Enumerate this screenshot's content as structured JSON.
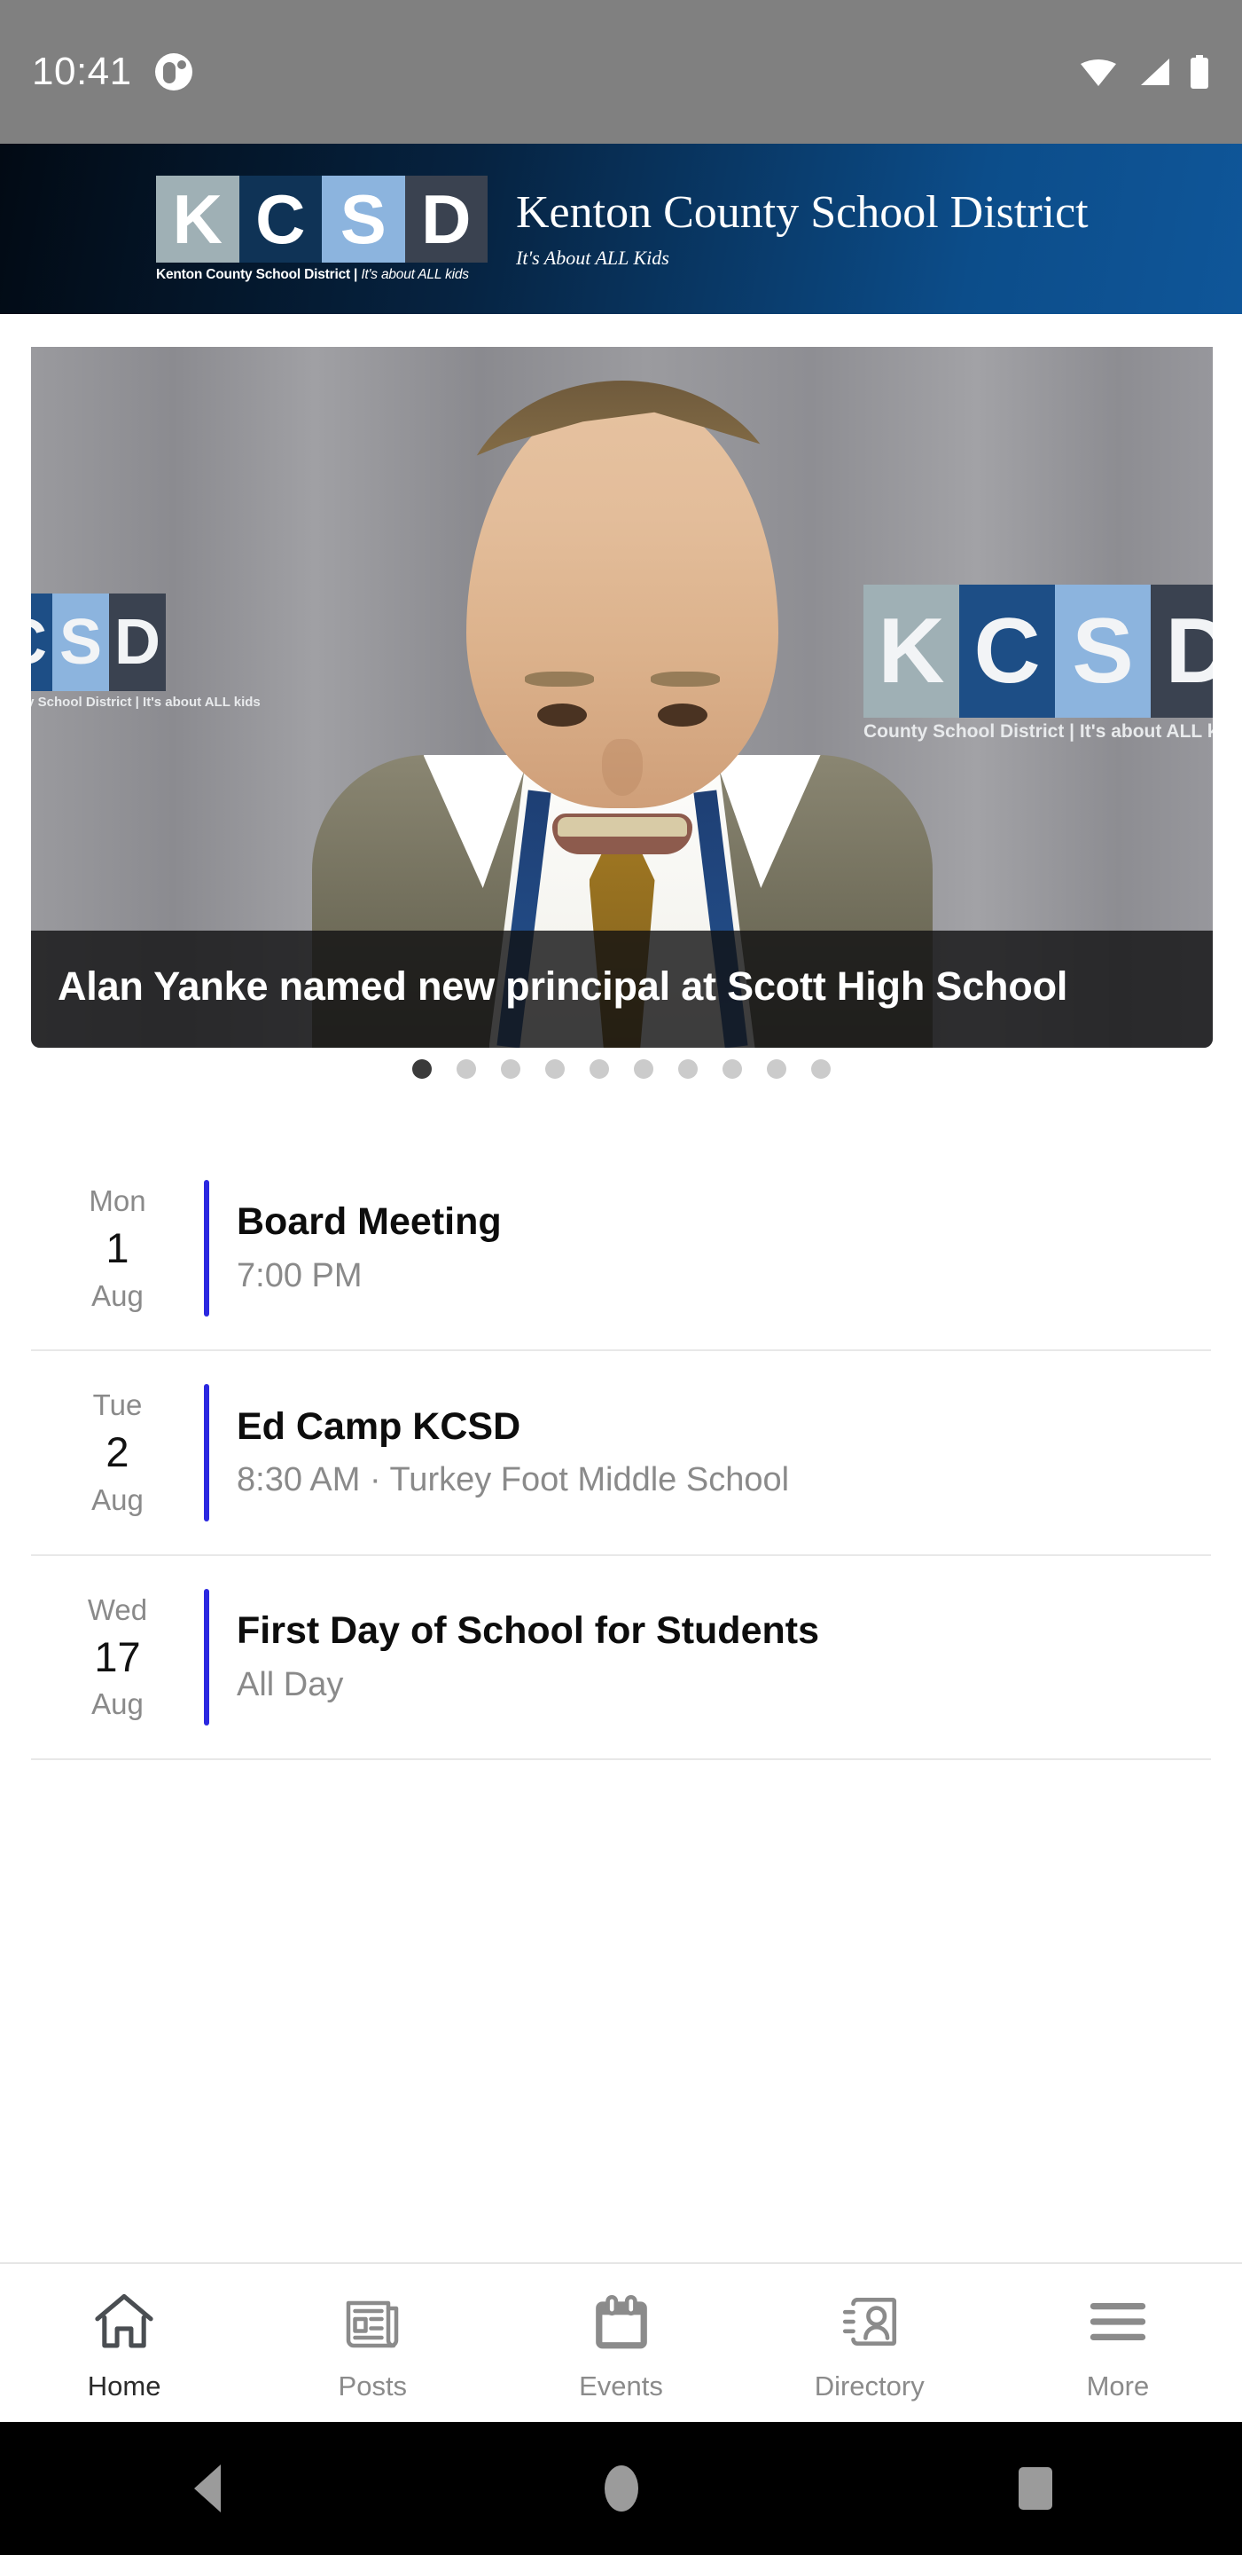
{
  "status_bar": {
    "time": "10:41",
    "notification_icon": "app-notification-icon",
    "wifi_icon": "wifi-icon",
    "signal_icon": "cell-signal-icon",
    "battery_icon": "battery-full-icon"
  },
  "app_header": {
    "logo_letters": [
      "K",
      "C",
      "S",
      "D"
    ],
    "logo_tile_colors": [
      "#9fb0b5",
      "#0f3356",
      "#8cb4de",
      "#3a4250"
    ],
    "logo_caption_main": "Kenton County School District",
    "logo_caption_sep": " | ",
    "logo_caption_italic": "It's about ALL kids",
    "title": "Kenton County School District",
    "tagline": "It's About ALL Kids",
    "gradient_from": "#020a14",
    "gradient_to": "#0f5699"
  },
  "hero": {
    "caption": "Alan Yanke named new principal at Scott High School",
    "backdrop_letters": [
      "K",
      "C",
      "S",
      "D"
    ],
    "backdrop_caption_left": "Kenton County School District | It's about ALL kids",
    "backdrop_caption_right": "County School District | It's about ALL kids",
    "dots_total": 10,
    "active_dot_index": 0,
    "active_dot_color": "#3b3b3b",
    "inactive_dot_color": "#cbcbcb"
  },
  "events": {
    "accent_color": "#2b28e0",
    "items": [
      {
        "dow": "Mon",
        "day": "1",
        "month": "Aug",
        "title": "Board Meeting",
        "subtitle": "7:00 PM"
      },
      {
        "dow": "Tue",
        "day": "2",
        "month": "Aug",
        "title": "Ed Camp KCSD",
        "subtitle": "8:30 AM · Turkey Foot Middle School"
      },
      {
        "dow": "Wed",
        "day": "17",
        "month": "Aug",
        "title": "First Day of School for Students",
        "subtitle": "All Day"
      }
    ]
  },
  "tab_bar": {
    "active_index": 0,
    "tabs": [
      {
        "label": "Home",
        "icon": "home-icon"
      },
      {
        "label": "Posts",
        "icon": "newspaper-icon"
      },
      {
        "label": "Events",
        "icon": "calendar-icon"
      },
      {
        "label": "Directory",
        "icon": "contact-card-icon"
      },
      {
        "label": "More",
        "icon": "hamburger-menu-icon"
      }
    ]
  },
  "android_nav": {
    "back": "back-button",
    "home": "home-button",
    "recents": "recents-button"
  }
}
